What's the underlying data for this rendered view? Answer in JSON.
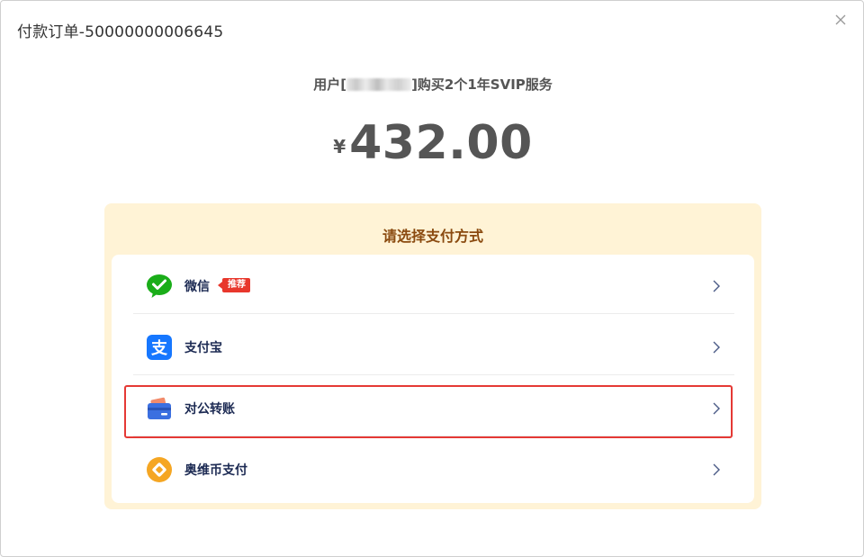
{
  "dialog": {
    "title": "付款订单-50000000006645",
    "close_icon": "close-icon"
  },
  "order": {
    "prefix": "用户[",
    "suffix": "]购买2个1年SVIP服务"
  },
  "amount": {
    "currency": "¥",
    "value": "432.00"
  },
  "payment": {
    "title": "请选择支付方式",
    "methods": [
      {
        "label": "微信",
        "icon": "wechat-icon",
        "badge": "推荐",
        "color": "#1aad19"
      },
      {
        "label": "支付宝",
        "icon": "alipay-icon",
        "color": "#1677ff"
      },
      {
        "label": "对公转账",
        "icon": "bank-card-icon",
        "color": "#3b6fe0",
        "highlighted": true
      },
      {
        "label": "奥维币支付",
        "icon": "ovi-coin-icon",
        "color": "#f5a623"
      }
    ]
  },
  "colors": {
    "panel_bg": "#fff3d6",
    "panel_title": "#8a4a0f",
    "highlight": "#e53935",
    "label": "#1c2a53"
  }
}
